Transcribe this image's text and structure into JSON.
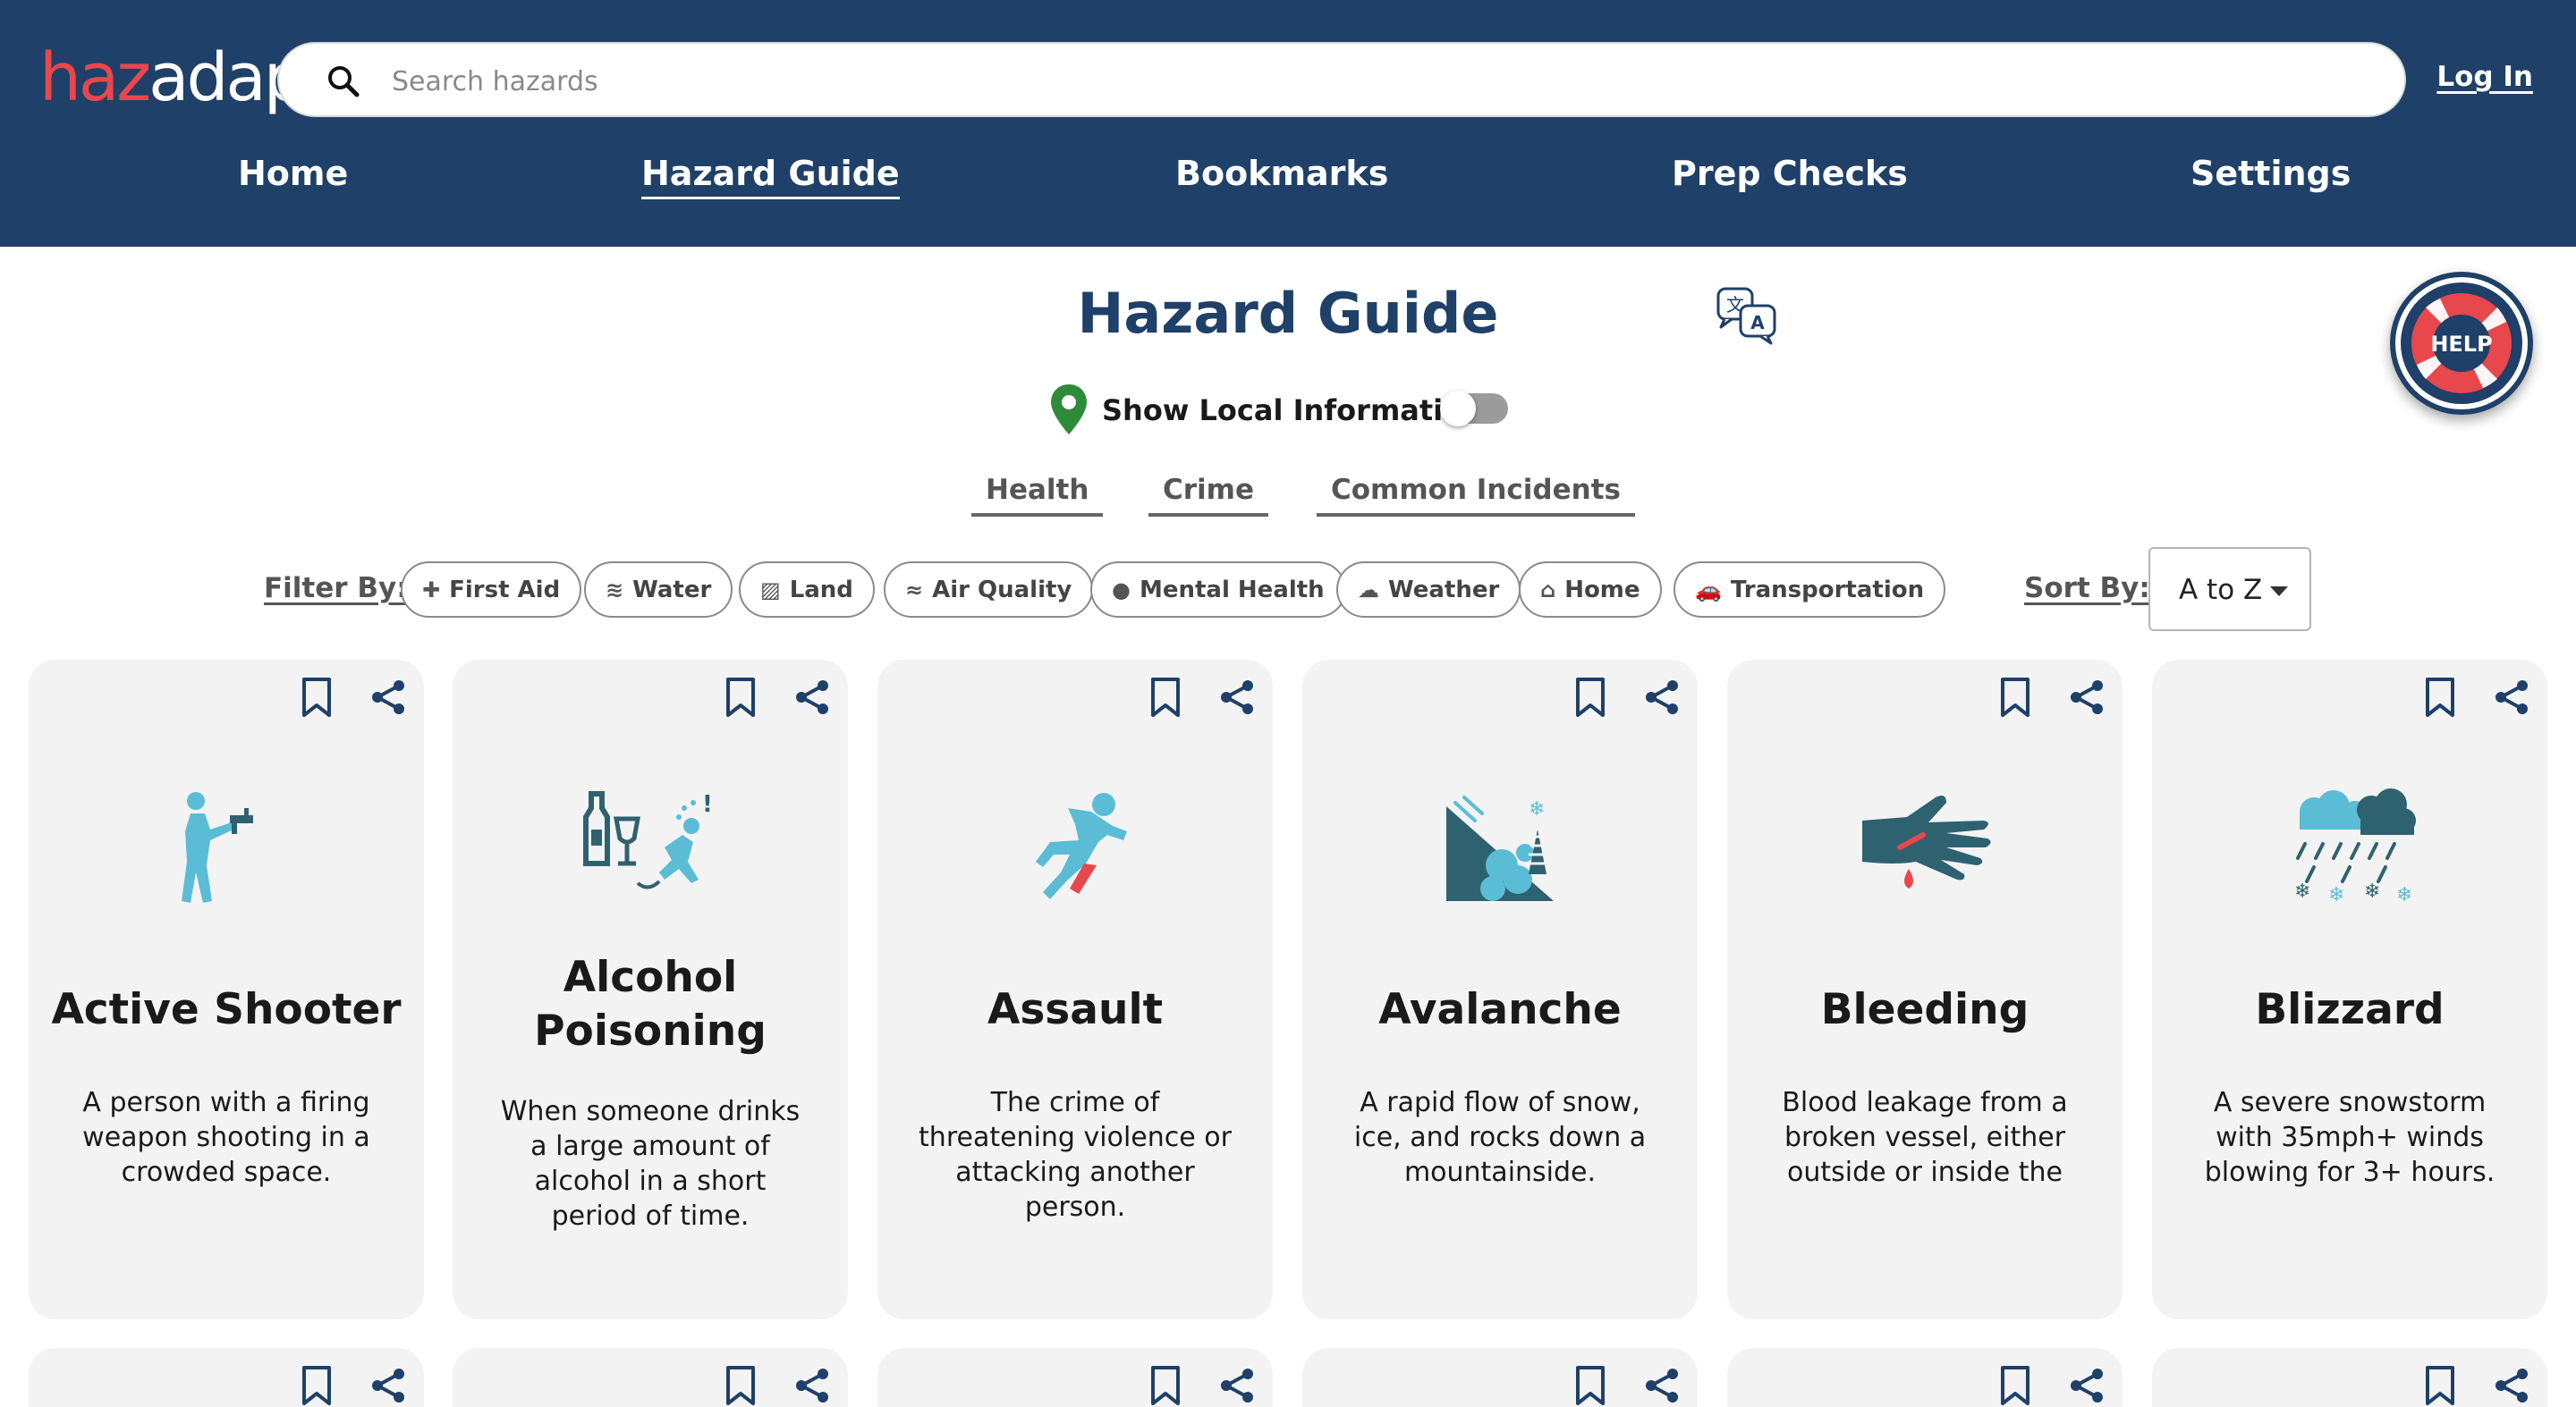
{
  "header": {
    "logo_part1": "haz",
    "logo_part2": "adapt",
    "search_placeholder": "Search hazards",
    "login_label": "Log In"
  },
  "nav": {
    "items": [
      {
        "label": "Home",
        "active": false
      },
      {
        "label": "Hazard Guide",
        "active": true
      },
      {
        "label": "Bookmarks",
        "active": false
      },
      {
        "label": "Prep Checks",
        "active": false
      },
      {
        "label": "Settings",
        "active": false
      }
    ]
  },
  "page": {
    "title": "Hazard Guide",
    "local_info_label": "Show Local Information",
    "local_info_enabled": false,
    "help_label": "HELP"
  },
  "categories": [
    "Health",
    "Crime",
    "Common Incidents"
  ],
  "filters": {
    "label": "Filter By:",
    "chips": [
      {
        "label": "First Aid",
        "icon": "first-aid-icon"
      },
      {
        "label": "Water",
        "icon": "water-icon"
      },
      {
        "label": "Land",
        "icon": "land-icon"
      },
      {
        "label": "Air Quality",
        "icon": "air-quality-icon"
      },
      {
        "label": "Mental Health",
        "icon": "mental-health-icon"
      },
      {
        "label": "Weather",
        "icon": "weather-icon"
      },
      {
        "label": "Home",
        "icon": "home-icon"
      },
      {
        "label": "Transportation",
        "icon": "car-icon"
      }
    ]
  },
  "sort": {
    "label": "Sort By:",
    "value": "A to Z"
  },
  "cards": [
    {
      "title": "Active Shooter",
      "description": "A person with a firing weapon shooting in a crowded space.",
      "icon": "active-shooter-icon"
    },
    {
      "title": "Alcohol Poisoning",
      "description": "When someone drinks a large amount of alcohol in a short period of time.",
      "icon": "alcohol-poisoning-icon"
    },
    {
      "title": "Assault",
      "description": "The crime of threatening violence or attacking another person.",
      "icon": "assault-icon"
    },
    {
      "title": "Avalanche",
      "description": "A rapid flow of snow, ice, and rocks down a mountainside.",
      "icon": "avalanche-icon"
    },
    {
      "title": "Bleeding",
      "description": "Blood leakage from a broken vessel, either outside or inside the",
      "icon": "bleeding-icon"
    },
    {
      "title": "Blizzard",
      "description": "A severe snowstorm with 35mph+ winds blowing for 3+ hours.",
      "icon": "blizzard-icon"
    }
  ],
  "colors": {
    "header_bg": "#1f4068",
    "brand_red": "#e8474c",
    "icon_teal": "#2f6270",
    "icon_light_blue": "#5bbcd6",
    "card_bg": "#f3f3f3"
  }
}
